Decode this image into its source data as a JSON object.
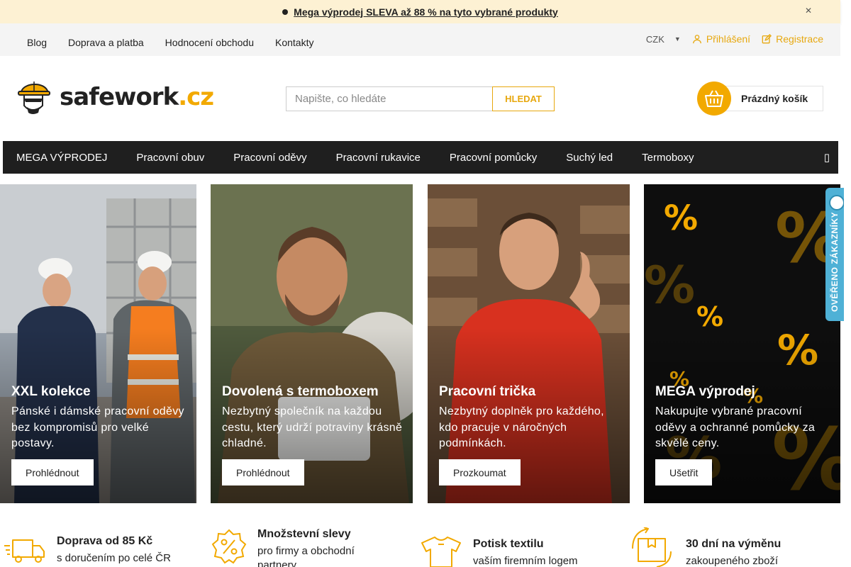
{
  "announcement": {
    "text": "Mega výprodej SLEVA až 88 % na tyto vybrané produkty",
    "close_icon": "close-icon"
  },
  "top_nav": [
    "Blog",
    "Doprava a platba",
    "Hodnocení obchodu",
    "Kontakty"
  ],
  "currency": "CZK",
  "account": {
    "login": "Přihlášení",
    "register": "Registrace"
  },
  "logo": {
    "name": "safework",
    "tld": ".cz"
  },
  "search": {
    "placeholder": "Napište, co hledáte",
    "button": "HLEDAT"
  },
  "cart": {
    "label": "Prázdný košík"
  },
  "menu": [
    "MEGA VÝPRODEJ",
    "Pracovní obuv",
    "Pracovní oděvy",
    "Pracovní rukavice",
    "Pracovní pomůcky",
    "Suchý led",
    "Termoboxy"
  ],
  "banners": [
    {
      "title": "XXL kolekce",
      "text": "Pánské i dámské pracovní oděvy bez kompromisů pro velké postavy.",
      "button": "Prohlédnout"
    },
    {
      "title": "Dovolená s termoboxem",
      "text": "Nezbytný společník na každou cestu, který udrží potraviny krásně chladné.",
      "button": "Prohlédnout"
    },
    {
      "title": "Pracovní trička",
      "text": "Nezbytný doplněk pro každého, kdo pracuje v náročných podmínkách.",
      "button": "Prozkoumat"
    },
    {
      "title": "MEGA výprodej",
      "text": "Nakupujte vybrané pracovní oděvy a ochranné pomůcky za skvělé ceny.",
      "button": "Ušetřit"
    }
  ],
  "verified_badge": "OVĚŘENO ZÁKAZNÍKY",
  "benefits": [
    {
      "title": "Doprava od 85 Kč",
      "text": "s doručením po celé ČR"
    },
    {
      "title": "Množstevní slevy",
      "text": "pro firmy a obchodní partnery"
    },
    {
      "title": "Potisk textilu",
      "text": "vaším firemním logem"
    },
    {
      "title": "30 dní na výměnu",
      "text": "zakoupeného zboží"
    }
  ],
  "colors": {
    "accent": "#f2a900",
    "menu_bg": "#1f1f1f",
    "announce_bg": "#fdf1d3"
  }
}
